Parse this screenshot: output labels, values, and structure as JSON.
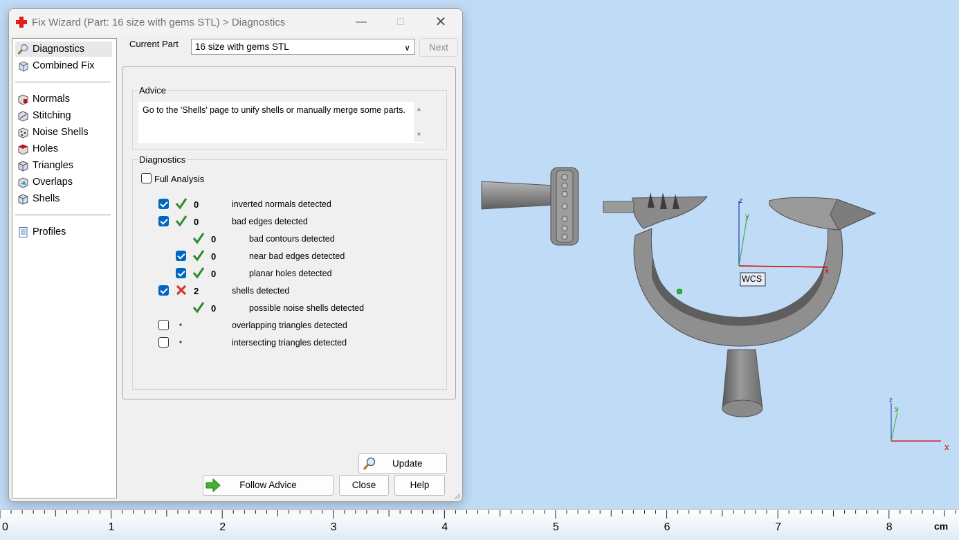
{
  "window": {
    "title": "Fix Wizard (Part: 16 size with gems STL) > Diagnostics",
    "minimize_icon": "minimize-icon",
    "maximize_icon": "maximize-icon",
    "close_icon": "close-icon"
  },
  "sidebar": {
    "groups": [
      [
        {
          "label": "Diagnostics",
          "icon": "magnifier-icon",
          "selected": true
        },
        {
          "label": "Combined Fix",
          "icon": "cube-icon"
        }
      ],
      [
        {
          "label": "Normals",
          "icon": "normals-icon"
        },
        {
          "label": "Stitching",
          "icon": "stitching-icon"
        },
        {
          "label": "Noise Shells",
          "icon": "noise-shells-icon"
        },
        {
          "label": "Holes",
          "icon": "holes-icon"
        },
        {
          "label": "Triangles",
          "icon": "triangles-icon"
        },
        {
          "label": "Overlaps",
          "icon": "overlaps-icon"
        },
        {
          "label": "Shells",
          "icon": "shells-icon"
        }
      ],
      [
        {
          "label": "Profiles",
          "icon": "document-icon"
        }
      ]
    ]
  },
  "header": {
    "current_part_label": "Current Part",
    "current_part_value": "16 size with gems STL",
    "next_label": "Next"
  },
  "advice": {
    "title": "Advice",
    "text": "Go to the 'Shells' page to unify shells or manually merge some parts."
  },
  "diagnostics": {
    "title": "Diagnostics",
    "full_analysis_label": "Full Analysis",
    "full_analysis_checked": false,
    "rows": [
      {
        "checkbox": "checked",
        "status": "ok",
        "count": "0",
        "label": "inverted normals detected",
        "indent": 0
      },
      {
        "checkbox": "checked",
        "status": "ok",
        "count": "0",
        "label": "bad edges detected",
        "indent": 0
      },
      {
        "checkbox": "none",
        "status": "ok",
        "count": "0",
        "label": "bad contours detected",
        "indent": 1
      },
      {
        "checkbox": "checked",
        "status": "ok",
        "count": "0",
        "label": "near bad edges detected",
        "indent": 1
      },
      {
        "checkbox": "checked",
        "status": "ok",
        "count": "0",
        "label": "planar holes detected",
        "indent": 1
      },
      {
        "checkbox": "checked",
        "status": "error",
        "count": "2",
        "label": "shells detected",
        "indent": 0
      },
      {
        "checkbox": "none",
        "status": "ok",
        "count": "0",
        "label": "possible noise shells detected",
        "indent": 1
      },
      {
        "checkbox": "unchecked",
        "status": "dot",
        "count": "",
        "label": "overlapping triangles detected",
        "indent": 0
      },
      {
        "checkbox": "unchecked",
        "status": "dot",
        "count": "",
        "label": "intersecting triangles detected",
        "indent": 0
      }
    ],
    "update_label": "Update"
  },
  "footer": {
    "follow_advice_label": "Follow Advice",
    "close_label": "Close",
    "help_label": "Help"
  },
  "viewport": {
    "wcs_label": "WCS",
    "axis_z": "z",
    "axis_y": "y",
    "axis_x": "x",
    "colors": {
      "background": "#c0dbf6",
      "x_axis": "#d40000",
      "y_axis": "#3ab03a",
      "z_axis": "#1a3fa8"
    }
  },
  "ruler": {
    "unit": "cm",
    "labels": [
      "0",
      "1",
      "2",
      "3",
      "4",
      "5",
      "6",
      "7",
      "8"
    ]
  }
}
